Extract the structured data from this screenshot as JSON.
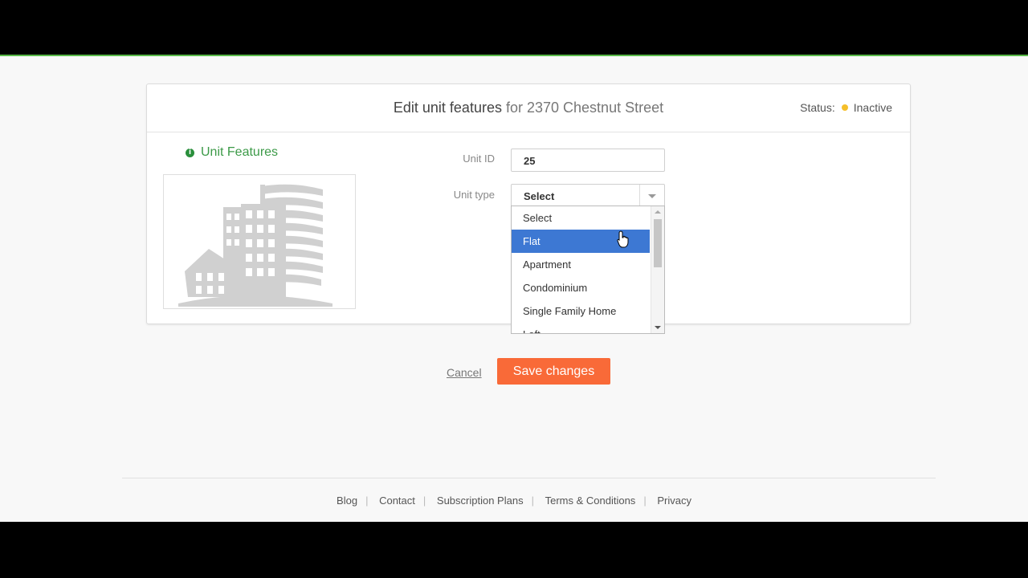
{
  "header": {
    "title_main": "Edit unit features",
    "title_for": "for 2370 Chestnut Street",
    "status_label": "Status:",
    "status_value": "Inactive",
    "status_color": "#f5bf2a"
  },
  "section": {
    "title": "Unit Features",
    "image_icon": "apartment-building-illustration"
  },
  "form": {
    "unit_id_label": "Unit ID",
    "unit_id_value": "25",
    "unit_type_label": "Unit type",
    "unit_type_value": "Select"
  },
  "dropdown": {
    "options": [
      "Select",
      "Flat",
      "Apartment",
      "Condominium",
      "Single Family Home",
      "Loft"
    ],
    "highlighted": "Flat"
  },
  "actions": {
    "cancel_label": "Cancel",
    "save_label": "Save changes",
    "save_color": "#f96a38"
  },
  "footer": {
    "links": [
      "Blog",
      "Contact",
      "Subscription Plans",
      "Terms & Conditions",
      "Privacy"
    ]
  },
  "colors": {
    "accent_green": "#3c9a48",
    "selection_blue": "#3d78d3"
  }
}
